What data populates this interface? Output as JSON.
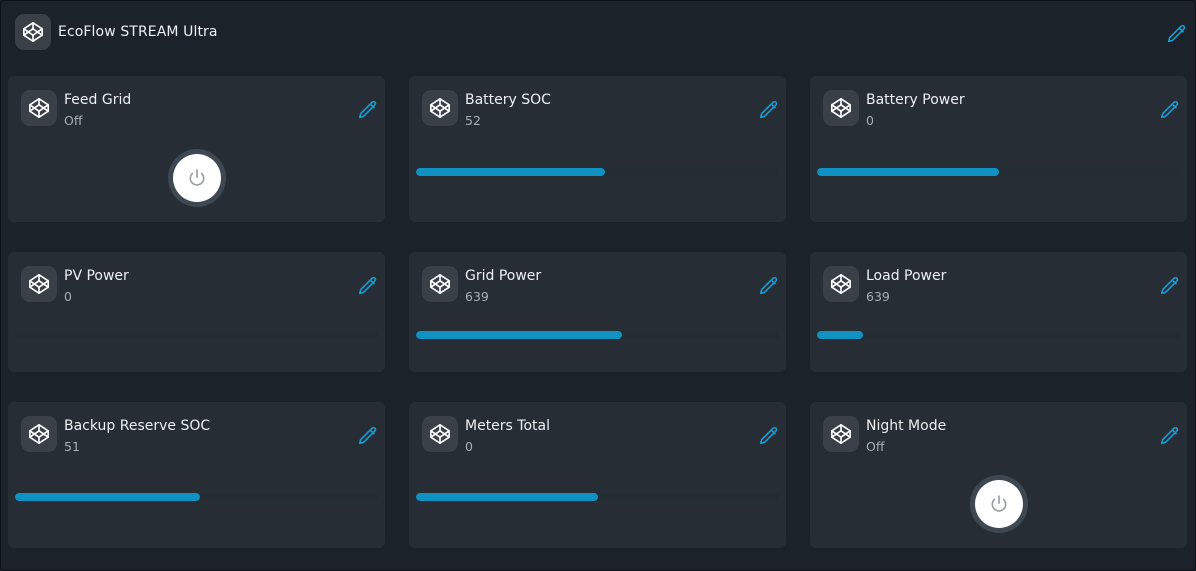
{
  "header": {
    "title": "EcoFlow STREAM Ultra",
    "icon": "codepen-icon"
  },
  "colors": {
    "accent": "#0f92c1",
    "card": "#272d34",
    "background": "#1c2229"
  },
  "cards": [
    {
      "id": "feed-grid",
      "title": "Feed Grid",
      "value": "Off",
      "kind": "toggle"
    },
    {
      "id": "battery-soc",
      "title": "Battery SOC",
      "value": "52",
      "kind": "bar",
      "level": 0.52
    },
    {
      "id": "battery-power",
      "title": "Battery Power",
      "value": "0",
      "kind": "bar",
      "level": 0.5
    },
    {
      "id": "pv-power",
      "title": "PV Power",
      "value": "0",
      "kind": "bar",
      "level": 0
    },
    {
      "id": "grid-power",
      "title": "Grid Power",
      "value": "639",
      "kind": "bar",
      "level": 0.567
    },
    {
      "id": "load-power",
      "title": "Load Power",
      "value": "639",
      "kind": "bar",
      "level": 0.128
    },
    {
      "id": "backup-reserve-soc",
      "title": "Backup Reserve SOC",
      "value": "51",
      "kind": "bar",
      "level": 0.51
    },
    {
      "id": "meters-total",
      "title": "Meters Total",
      "value": "0",
      "kind": "bar",
      "level": 0.5
    },
    {
      "id": "night-mode",
      "title": "Night Mode",
      "value": "Off",
      "kind": "toggle"
    }
  ]
}
